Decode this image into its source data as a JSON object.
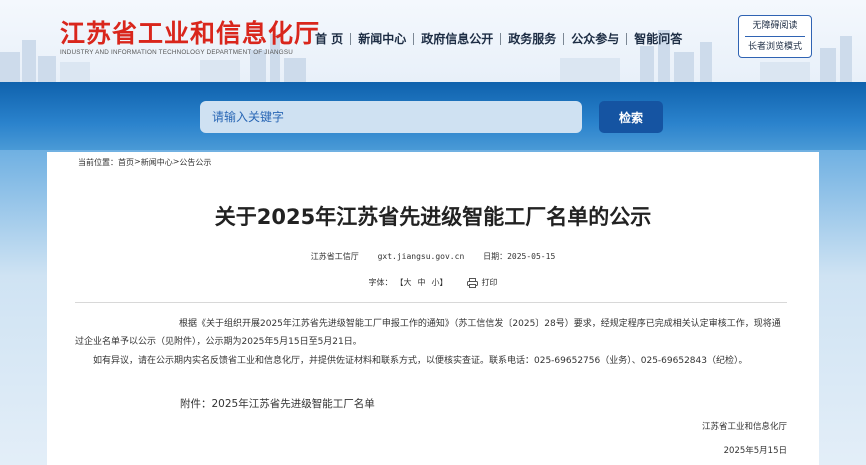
{
  "header": {
    "site_name_cn": "江苏省工业和信息化厅",
    "site_name_en": "INDUSTRY AND INFORMATION TECHNOLOGY DEPARTMENT OF JIANGSU",
    "nav": [
      "首 页",
      "新闻中心",
      "政府信息公开",
      "政务服务",
      "公众参与",
      "智能问答"
    ],
    "accessibility": {
      "barrier_free": "无障碍阅读",
      "elder_mode": "长者浏览模式"
    }
  },
  "search": {
    "placeholder": "请输入关键字",
    "button": "检索"
  },
  "breadcrumb": {
    "label": "当前位置：",
    "items": [
      "首页",
      "新闻中心",
      "公告公示"
    ],
    "separator": ">"
  },
  "article": {
    "title": "关于2025年江苏省先进级智能工厂名单的公示",
    "source": "江苏省工信厅",
    "site": "gxt.jiangsu.gov.cn",
    "date_label": "日期：",
    "date": "2025-05-15",
    "font_label": "字体：",
    "font_sizes": [
      "【大",
      "中",
      "小】"
    ],
    "print": "打印",
    "paragraph1": "根据《关于组织开展2025年江苏省先进级智能工厂申报工作的通知》（苏工信信发〔2025〕28号）要求，经规定程序已完成相关认定审核工作，现将通过企业名单予以公示（见附件），公示期为2025年5月15日至5月21日。",
    "paragraph2": "如有异议，请在公示期内实名反馈省工业和信息化厅，并提供佐证材料和联系方式，以便核实查证。联系电话：025-69652756（业务）、025-69652843（纪检）。",
    "attachment": "附件：2025年江苏省先进级智能工厂名单",
    "signature_org": "江苏省工业和信息化厅",
    "signature_date": "2025年5月15日"
  },
  "colors": {
    "brand_red": "#d9261c",
    "band_blue": "#0f62ad",
    "button_blue": "#1554a2",
    "search_bg": "#cfe1f2"
  }
}
